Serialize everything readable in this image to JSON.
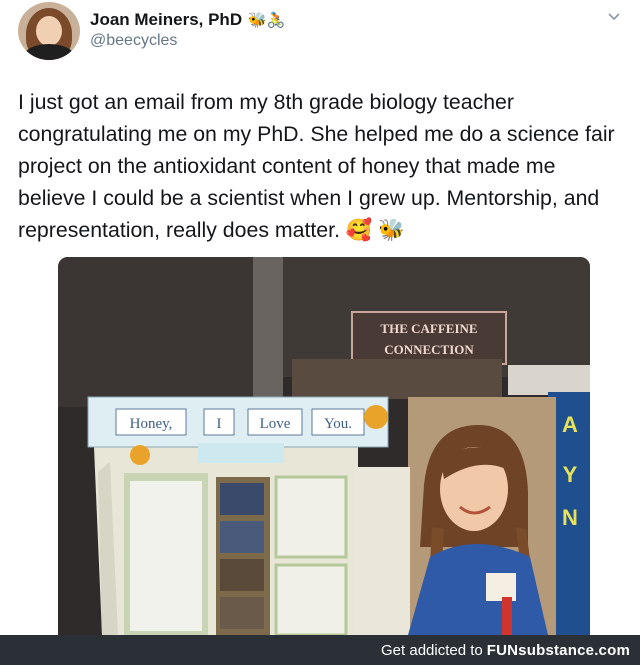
{
  "tweet": {
    "author": {
      "display_name": "Joan Meiners, PhD",
      "name_emoji": "🐝🚴",
      "handle": "@beecycles"
    },
    "text": "I just got an email from my 8th grade biology teacher congratulating me on my PhD. She helped me do a science fair project on the antioxidant content of honey that made me believe I could be a scientist when I grew up. Mentorship, and representation, really does matter. 🥰 🐝",
    "photo": {
      "board_title_words": [
        "Honey,",
        "I",
        "Love",
        "You."
      ],
      "sign_line_1": "THE CAFFEINE",
      "sign_line_2": "CONNECTION",
      "background_letters": [
        "A",
        "Y",
        "N"
      ]
    }
  },
  "footer": {
    "prefix": "Get addicted to",
    "brand": "FUNsubstance",
    "suffix": ".com"
  }
}
